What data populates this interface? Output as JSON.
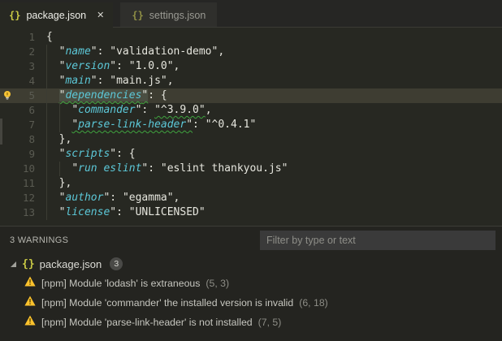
{
  "tabs": [
    {
      "label": "package.json",
      "icon": "{}",
      "close": "✕",
      "active": true
    },
    {
      "label": "settings.json",
      "icon": "{}",
      "active": false
    }
  ],
  "code": {
    "lines": [
      {
        "num": "1",
        "indent": 0,
        "tokens": [
          {
            "t": "{",
            "cls": "punc"
          }
        ]
      },
      {
        "num": "2",
        "indent": 2,
        "guides": [
          0
        ],
        "tokens": [
          {
            "t": "\"",
            "cls": "punc"
          },
          {
            "t": "name",
            "cls": "key"
          },
          {
            "t": "\": ",
            "cls": "punc"
          },
          {
            "t": "\"validation-demo\",",
            "cls": "str"
          }
        ]
      },
      {
        "num": "3",
        "indent": 2,
        "guides": [
          0
        ],
        "tokens": [
          {
            "t": "\"",
            "cls": "punc"
          },
          {
            "t": "version",
            "cls": "key"
          },
          {
            "t": "\": ",
            "cls": "punc"
          },
          {
            "t": "\"1.0.0\",",
            "cls": "str"
          }
        ]
      },
      {
        "num": "4",
        "indent": 2,
        "guides": [
          0
        ],
        "tokens": [
          {
            "t": "\"",
            "cls": "punc"
          },
          {
            "t": "main",
            "cls": "key"
          },
          {
            "t": "\": ",
            "cls": "punc"
          },
          {
            "t": "\"main.js\",",
            "cls": "str"
          }
        ]
      },
      {
        "num": "5",
        "indent": 2,
        "guides": [
          0
        ],
        "current": true,
        "lightbulb": true,
        "tokens": [
          {
            "t": "\"",
            "cls": "punc",
            "hl": 1,
            "sq": 1
          },
          {
            "t": "dependencies",
            "cls": "key",
            "hl": 1,
            "sq": 1
          },
          {
            "t": "\"",
            "cls": "punc",
            "hl": 1,
            "sq": 1
          },
          {
            "t": ": {",
            "cls": "punc"
          }
        ]
      },
      {
        "num": "6",
        "indent": 4,
        "guides": [
          0,
          2
        ],
        "tokens": [
          {
            "t": "\"",
            "cls": "punc"
          },
          {
            "t": "commander",
            "cls": "key"
          },
          {
            "t": "\": ",
            "cls": "punc"
          },
          {
            "t": "\"^3.9.0\"",
            "cls": "str",
            "sq": 1
          },
          {
            "t": ",",
            "cls": "str"
          }
        ]
      },
      {
        "num": "7",
        "indent": 4,
        "guides": [
          0,
          2
        ],
        "tokens": [
          {
            "t": "\"",
            "cls": "punc",
            "sq": 1
          },
          {
            "t": "parse-link-header",
            "cls": "key",
            "sq": 1
          },
          {
            "t": "\"",
            "cls": "punc",
            "sq": 1
          },
          {
            "t": ": ",
            "cls": "punc"
          },
          {
            "t": "\"^0.4.1\"",
            "cls": "str"
          }
        ]
      },
      {
        "num": "8",
        "indent": 2,
        "guides": [
          0
        ],
        "tokens": [
          {
            "t": "},",
            "cls": "punc"
          }
        ]
      },
      {
        "num": "9",
        "indent": 2,
        "guides": [
          0
        ],
        "tokens": [
          {
            "t": "\"",
            "cls": "punc"
          },
          {
            "t": "scripts",
            "cls": "key"
          },
          {
            "t": "\": {",
            "cls": "punc"
          }
        ]
      },
      {
        "num": "10",
        "indent": 4,
        "guides": [
          0,
          2
        ],
        "tokens": [
          {
            "t": "\"",
            "cls": "punc"
          },
          {
            "t": "run eslint",
            "cls": "key"
          },
          {
            "t": "\": ",
            "cls": "punc"
          },
          {
            "t": "\"eslint thankyou.js\"",
            "cls": "str"
          }
        ]
      },
      {
        "num": "11",
        "indent": 2,
        "guides": [
          0
        ],
        "tokens": [
          {
            "t": "},",
            "cls": "punc"
          }
        ]
      },
      {
        "num": "12",
        "indent": 2,
        "guides": [
          0
        ],
        "tokens": [
          {
            "t": "\"",
            "cls": "punc"
          },
          {
            "t": "author",
            "cls": "key"
          },
          {
            "t": "\": ",
            "cls": "punc"
          },
          {
            "t": "\"egamma\",",
            "cls": "str"
          }
        ]
      },
      {
        "num": "13",
        "indent": 2,
        "guides": [
          0
        ],
        "tokens": [
          {
            "t": "\"",
            "cls": "punc"
          },
          {
            "t": "license",
            "cls": "key"
          },
          {
            "t": "\": ",
            "cls": "punc"
          },
          {
            "t": "\"UNLICENSED\"",
            "cls": "str"
          }
        ]
      }
    ]
  },
  "panel": {
    "summary": "3 WARNINGS",
    "filter_placeholder": "Filter by type or text",
    "group": {
      "icon": "{}",
      "name": "package.json",
      "badge": "3"
    },
    "problems": [
      {
        "source": "[npm]",
        "message": "Module 'lodash' is extraneous",
        "position": "(5, 3)"
      },
      {
        "source": "[npm]",
        "message": "Module 'commander' the installed version is invalid",
        "position": "(6, 18)"
      },
      {
        "source": "[npm]",
        "message": "Module 'parse-link-header' is not installed",
        "position": "(7, 5)"
      }
    ]
  },
  "colors": {
    "editor_bg": "#272822",
    "line_highlight": "#3e3d32",
    "word_highlight": "#4a4e42",
    "key_color": "#5cc8d8",
    "squiggle_green": "#3fa33f",
    "warning_yellow": "#fbc22d",
    "json_icon_yellow": "#cbcb45"
  }
}
